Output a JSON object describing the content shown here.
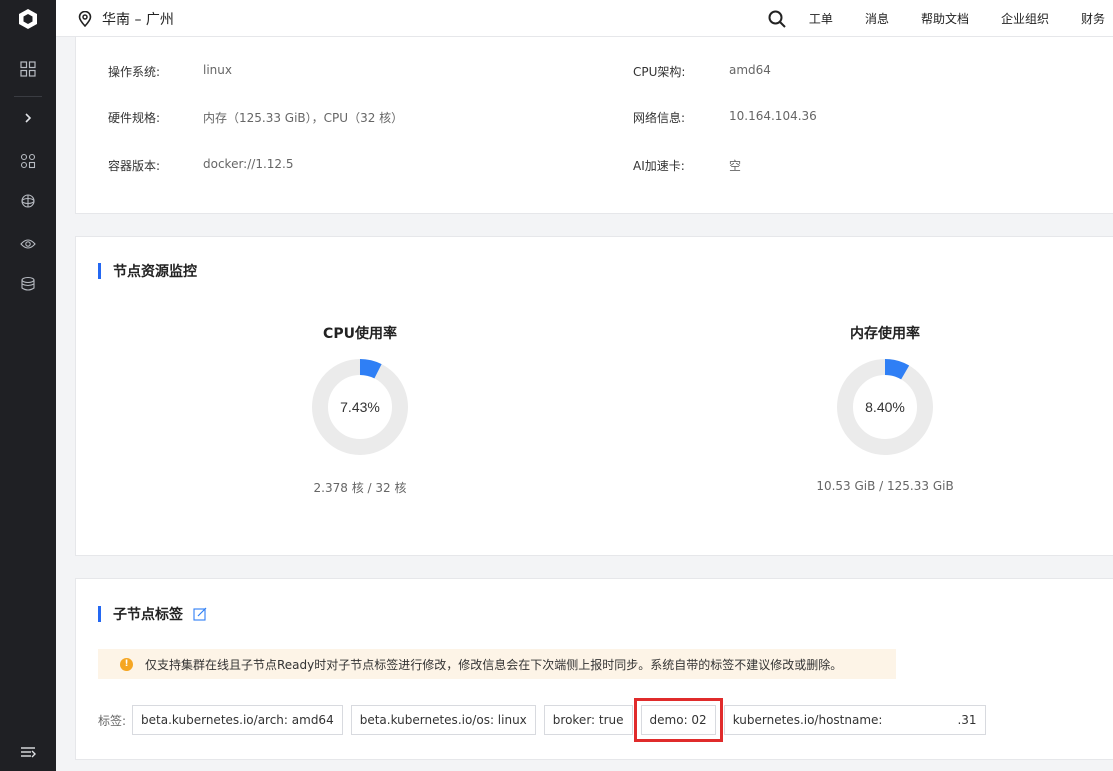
{
  "topbar": {
    "region": "华南 – 广州",
    "nav": [
      "工单",
      "消息",
      "帮助文档",
      "企业组织",
      "财务"
    ]
  },
  "node_info": {
    "os_label": "操作系统:",
    "os_value": "linux",
    "hw_label": "硬件规格:",
    "hw_value": "内存（125.33 GiB），CPU（32 核）",
    "container_label": "容器版本:",
    "container_value": "docker://1.12.5",
    "arch_label": "CPU架构:",
    "arch_value": "amd64",
    "net_label": "网络信息:",
    "net_value": "10.164.104.36",
    "ai_label": "AI加速卡:",
    "ai_value": "空"
  },
  "monitor": {
    "title": "节点资源监控",
    "cpu": {
      "title": "CPU使用率",
      "percent_text": "7.43%",
      "percent": 7.43,
      "detail": "2.378 核 / 32 核"
    },
    "mem": {
      "title": "内存使用率",
      "percent_text": "8.40%",
      "percent": 8.4,
      "detail": "10.53 GiB / 125.33 GiB"
    },
    "colors": {
      "used": "#2f7ff5",
      "track": "#ebebeb"
    }
  },
  "labels_section": {
    "title": "子节点标签",
    "notice": "仅支持集群在线且子节点Ready时对子节点标签进行修改，修改信息会在下次端侧上报时同步。系统自带的标签不建议修改或删除。",
    "prefix": "标签:",
    "tags": [
      "beta.kubernetes.io/arch: amd64",
      "beta.kubernetes.io/os: linux",
      "broker: true",
      "demo: 02"
    ],
    "hostname_tag_start": "kubernetes.io/hostname:",
    "hostname_tag_end": ".31"
  }
}
